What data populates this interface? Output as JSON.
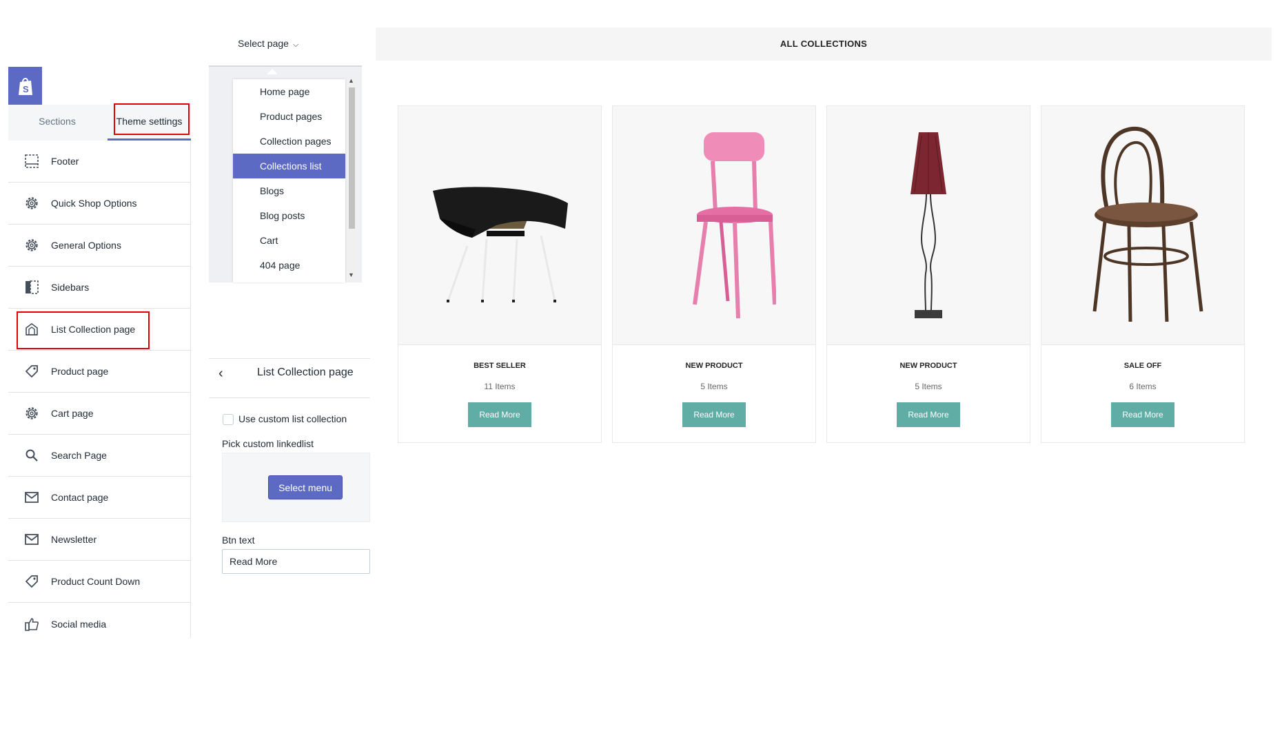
{
  "sidebar": {
    "tabs": {
      "sections": "Sections",
      "theme_settings": "Theme settings"
    },
    "items": [
      {
        "label": "Footer",
        "icon": "footer-icon"
      },
      {
        "label": "Quick Shop Options",
        "icon": "gear-icon"
      },
      {
        "label": "General Options",
        "icon": "gear-icon"
      },
      {
        "label": "Sidebars",
        "icon": "sidebar-icon"
      },
      {
        "label": "List Collection page",
        "icon": "collection-icon"
      },
      {
        "label": "Product page",
        "icon": "tag-icon"
      },
      {
        "label": "Cart page",
        "icon": "gear-icon"
      },
      {
        "label": "Search Page",
        "icon": "search-icon"
      },
      {
        "label": "Contact page",
        "icon": "mail-icon"
      },
      {
        "label": "Newsletter",
        "icon": "mail-icon"
      },
      {
        "label": "Product Count Down",
        "icon": "tag-icon"
      },
      {
        "label": "Social media",
        "icon": "thumbs-up-icon"
      }
    ]
  },
  "page_select": {
    "label": "Select page",
    "options": [
      "Home page",
      "Product pages",
      "Collection pages",
      "Collections list",
      "Blogs",
      "Blog posts",
      "Cart",
      "404 page"
    ],
    "selected": "Collections list"
  },
  "panel": {
    "title": "List Collection page",
    "checkbox_label": "Use custom list collection",
    "pick_label": "Pick custom linkedlist",
    "select_menu_button": "Select menu",
    "btn_text_label": "Btn text",
    "btn_text_value": "Read More"
  },
  "preview": {
    "title": "ALL COLLECTIONS",
    "cards": [
      {
        "title": "BEST SELLER",
        "count": "11 Items",
        "button": "Read More"
      },
      {
        "title": "NEW PRODUCT",
        "count": "5 Items",
        "button": "Read More"
      },
      {
        "title": "NEW PRODUCT",
        "count": "5 Items",
        "button": "Read More"
      },
      {
        "title": "SALE OFF",
        "count": "6 Items",
        "button": "Read More"
      }
    ]
  },
  "colors": {
    "accent": "#5c6ac4",
    "highlight": "#e00000",
    "card_button": "#5fada4"
  }
}
